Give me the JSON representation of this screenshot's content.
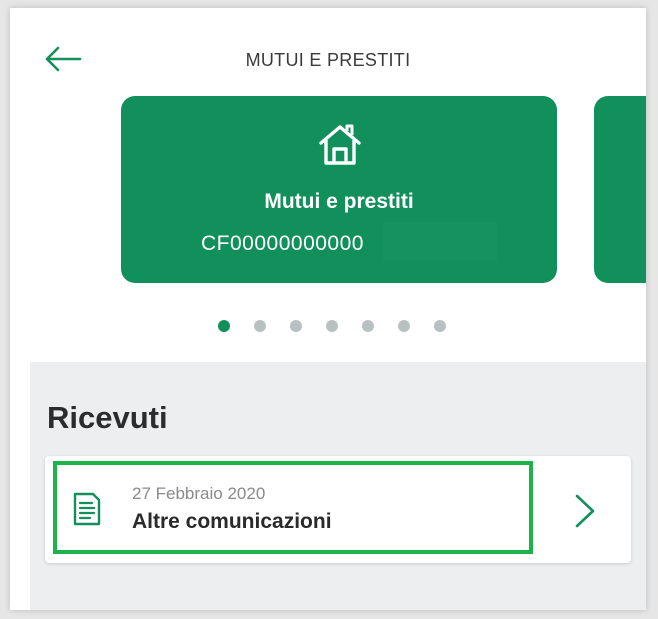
{
  "header": {
    "title": "MUTUI E PRESTITI"
  },
  "card": {
    "name": "Mutui e prestiti",
    "code": "CF00000000000"
  },
  "carousel": {
    "pages": 7,
    "active_index": 0
  },
  "section": {
    "title": "Ricevuti",
    "items": [
      {
        "date": "27 Febbraio 2020",
        "title": "Altre comunicazioni"
      }
    ]
  },
  "icons": {
    "back": "arrow-left-icon",
    "card": "home-icon",
    "document": "document-icon",
    "chevron": "chevron-right-icon"
  },
  "colors": {
    "brand_green": "#12905c",
    "highlight": "#1db24a",
    "section_bg": "#eceeef"
  }
}
